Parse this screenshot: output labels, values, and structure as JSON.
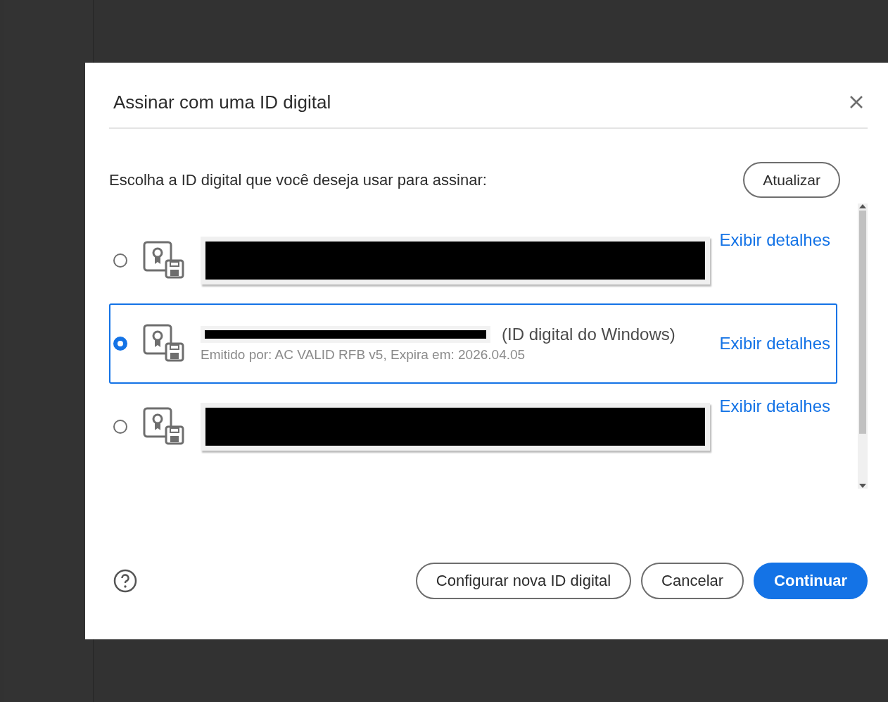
{
  "dialog": {
    "title": "Assinar com uma ID digital",
    "prompt": "Escolha a ID digital que você deseja usar para assinar:",
    "refresh_button": "Atualizar"
  },
  "ids": [
    {
      "kind": "redacted",
      "selected": false,
      "details_link": "Exibir detalhes"
    },
    {
      "kind": "partial",
      "selected": true,
      "suffix": "(ID digital do Windows)",
      "issuer": "Emitido por: AC VALID RFB v5, Expira em: 2026.04.05",
      "details_link": "Exibir detalhes"
    },
    {
      "kind": "redacted",
      "selected": false,
      "details_link": "Exibir detalhes"
    }
  ],
  "footer_buttons": [
    {
      "kind": "secondary",
      "label": "Configurar nova ID digital"
    },
    {
      "kind": "secondary",
      "label": "Cancelar"
    },
    {
      "kind": "primary",
      "label": "Continuar"
    }
  ]
}
